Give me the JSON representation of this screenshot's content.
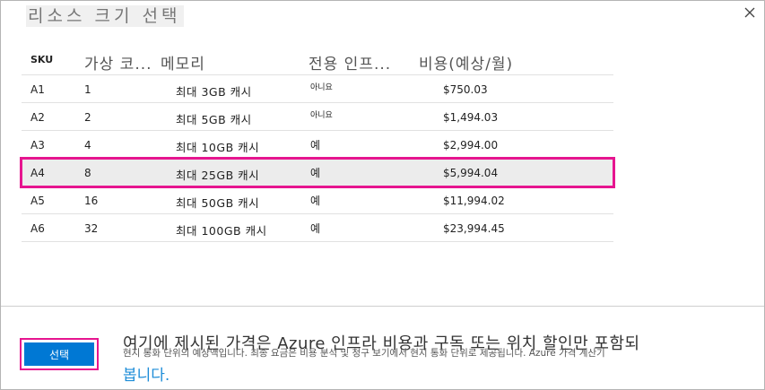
{
  "dialog": {
    "title": "리소스 크기 선택",
    "close_icon": "close-icon"
  },
  "table": {
    "columns": {
      "sku": "SKU",
      "vcpu": "가상 코...",
      "memory": "메모리",
      "dedicated": "전용 인프...",
      "cost": "비용(예상/월)"
    },
    "rows": [
      {
        "sku": "A1",
        "vcpu": "1",
        "memory": "최대 3GB 캐시",
        "dedicated": "아니요",
        "cost": "$750.03"
      },
      {
        "sku": "A2",
        "vcpu": "2",
        "memory": "최대 5GB 캐시",
        "dedicated": "아니요",
        "cost": "$1,494.03"
      },
      {
        "sku": "A3",
        "vcpu": "4",
        "memory": "최대 10GB 캐시",
        "dedicated": "예",
        "cost": "$2,994.00"
      },
      {
        "sku": "A4",
        "vcpu": "8",
        "memory": "최대 25GB 캐시",
        "dedicated": "예",
        "cost": "$5,994.04"
      },
      {
        "sku": "A5",
        "vcpu": "16",
        "memory": "최대 50GB 캐시",
        "dedicated": "예",
        "cost": "$11,994.02"
      },
      {
        "sku": "A6",
        "vcpu": "32",
        "memory": "최대 100GB 캐시",
        "dedicated": "예",
        "cost": "$23,994.45"
      }
    ],
    "selected_sku": "A4"
  },
  "footer": {
    "select_label": "선택",
    "note_line1": "여기에 제시된 가격은 Azure 인프라 비용과 구독 또는 위치 할인만 포함되",
    "note_line2": "현지 통화 단위의 예상액입니다. 최종 요금은 비용 분석 및 청구 보기에서 현지 통화 단위로 제공됩니다. Azure 가격 계산기",
    "note_link": "봅니다."
  },
  "colors": {
    "accent": "#0078d4",
    "highlight": "#e6158f",
    "link": "#1e8dd8"
  }
}
